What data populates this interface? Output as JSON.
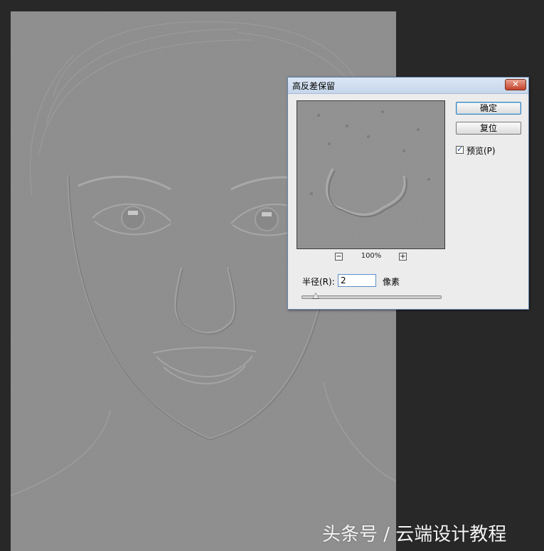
{
  "dialog": {
    "title": "高反差保留",
    "close_glyph": "✕",
    "ok_label": "确定",
    "reset_label": "复位",
    "preview_checked": true,
    "preview_label": "预览(P)",
    "zoom_out_glyph": "−",
    "zoom_in_glyph": "+",
    "zoom_level": "100%",
    "radius_label": "半径(R):",
    "radius_value": "2",
    "unit_label": "像素",
    "radius_slider_fraction": 0.1
  },
  "watermark": "头条号 / 云端设计教程",
  "icons": {
    "close": "close-icon",
    "zoom_out": "minus-icon",
    "zoom_in": "plus-icon",
    "check": "checkmark-icon"
  },
  "colors": {
    "workspace": "#282828",
    "canvas": "#8c8c8c",
    "dialog_bg": "#ececec",
    "close_button": "#c4432a"
  }
}
